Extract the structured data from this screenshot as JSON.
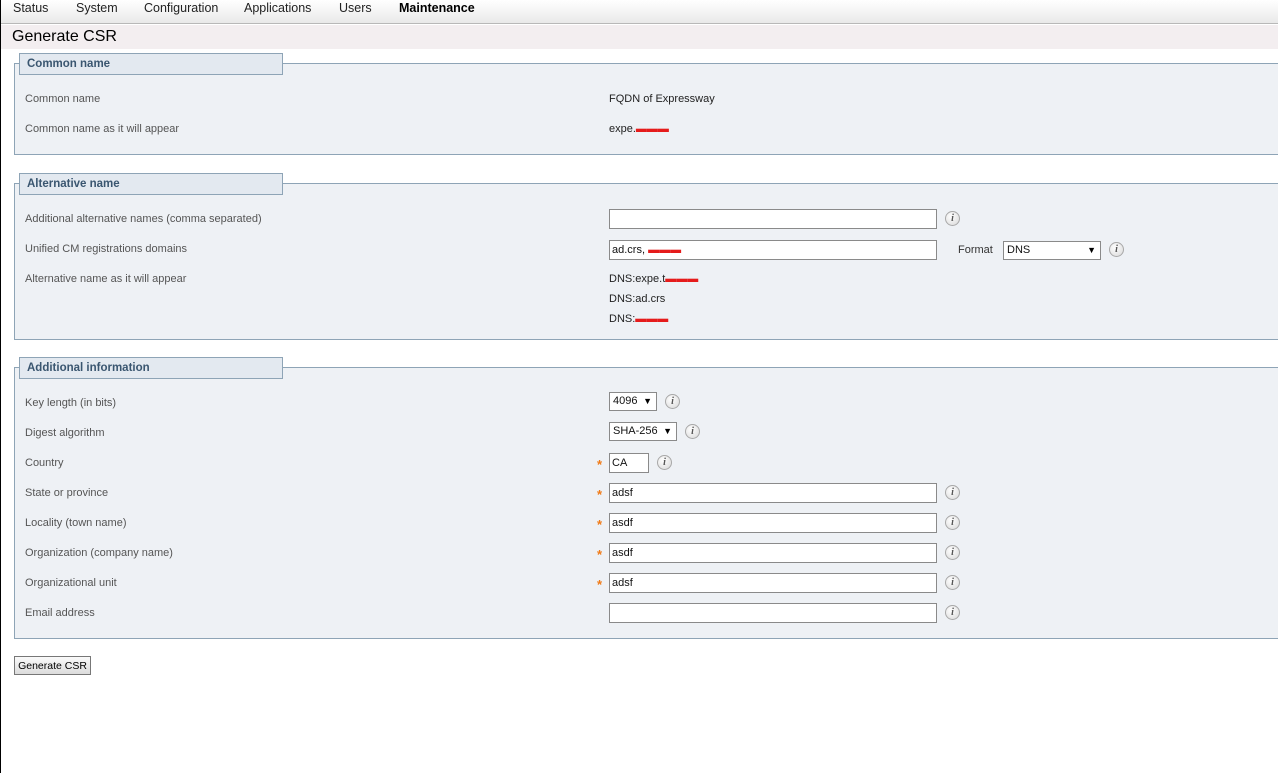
{
  "nav": {
    "items": [
      {
        "label": "Status",
        "active": false
      },
      {
        "label": "System",
        "active": false
      },
      {
        "label": "Configuration",
        "active": false
      },
      {
        "label": "Applications",
        "active": false
      },
      {
        "label": "Users",
        "active": false
      },
      {
        "label": "Maintenance",
        "active": true
      }
    ]
  },
  "page": {
    "title": "Generate CSR"
  },
  "common_name": {
    "heading": "Common name",
    "common_name_label": "Common name",
    "common_name_value": "FQDN of Expressway",
    "appear_label": "Common name as it will appear",
    "appear_value_prefix": "expe.",
    "appear_value_redacted": "[redacted]"
  },
  "alternative_name": {
    "heading": "Alternative name",
    "additional_label": "Additional alternative names (comma separated)",
    "additional_value": "",
    "ucm_label": "Unified CM registrations domains",
    "ucm_value_prefix": "ad.crs, ",
    "ucm_value_redacted": "[redacted]",
    "format_label": "Format",
    "format_value": "DNS",
    "appear_label": "Alternative name as it will appear",
    "appear_lines": [
      {
        "prefix": "DNS:expe.t",
        "redacted": "[redacted]"
      },
      {
        "prefix": "DNS:ad.crs",
        "redacted": ""
      },
      {
        "prefix": "DNS:",
        "redacted": "[redacted]"
      }
    ]
  },
  "additional_info": {
    "heading": "Additional information",
    "key_length_label": "Key length (in bits)",
    "key_length_value": "4096",
    "digest_label": "Digest algorithm",
    "digest_value": "SHA-256",
    "country_label": "Country",
    "country_value": "CA",
    "state_label": "State or province",
    "state_value": "adsf",
    "locality_label": "Locality (town name)",
    "locality_value": "asdf",
    "org_label": "Organization (company name)",
    "org_value": "asdf",
    "org_unit_label": "Organizational unit",
    "org_unit_value": "adsf",
    "email_label": "Email address",
    "email_value": ""
  },
  "actions": {
    "generate_label": "Generate CSR"
  },
  "colors": {
    "required_star": "#f07a16",
    "section_bg": "#eef1f5",
    "legend_text": "#3a5670",
    "redaction": "#e51b1b"
  },
  "icons": {
    "info": "info-icon",
    "required": "required-asterisk",
    "dropdown": "chevron-down-icon"
  }
}
